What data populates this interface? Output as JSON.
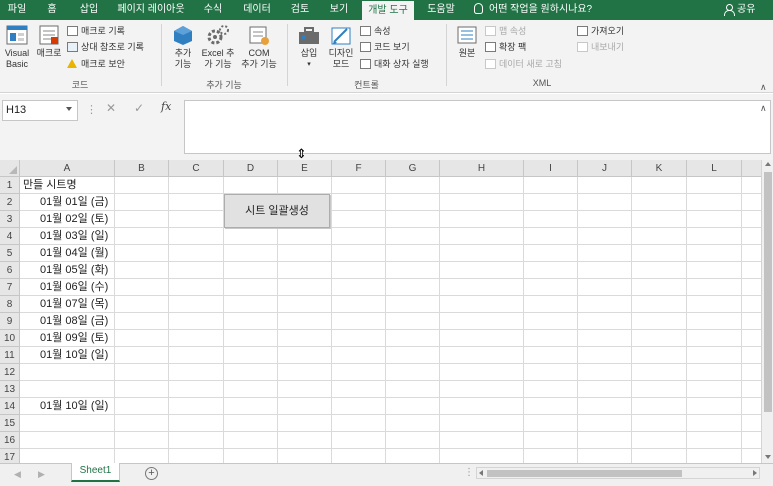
{
  "tabs": [
    "파일",
    "홈",
    "삽입",
    "페이지 레이아웃",
    "수식",
    "데이터",
    "검토",
    "보기",
    "개발 도구",
    "도움말"
  ],
  "active_tab": "개발 도구",
  "tell_me": "어떤 작업을 원하시나요?",
  "share": "공유",
  "ribbon": {
    "code": {
      "visual_basic": [
        "Visual",
        "Basic"
      ],
      "macro": "매크로",
      "record_macro": "매크로 기록",
      "relative_ref": "상대 참조로 기록",
      "macro_security": "매크로 보안",
      "group_label": "코드"
    },
    "addins": {
      "addins": [
        "추가",
        "기능"
      ],
      "excel_addins": [
        "Excel 추",
        "가 기능"
      ],
      "com_addins": [
        "COM",
        "추가 기능"
      ],
      "group_label": "추가 기능"
    },
    "controls": {
      "insert": "삽입",
      "design_mode": [
        "디자인",
        "모드"
      ],
      "properties": "속성",
      "view_code": "코드 보기",
      "run_dialog": "대화 상자 실행",
      "group_label": "컨트롤"
    },
    "xml": {
      "source": "원본",
      "map_properties": "맵 속성",
      "expansion_packs": "확장 팩",
      "refresh_data": "데이터 새로 고침",
      "import": "가져오기",
      "export": "내보내기",
      "group_label": "XML"
    }
  },
  "name_box": "H13",
  "formula_bar": {
    "cancel": "✕",
    "enter": "✓",
    "fx": "fx",
    "content": ""
  },
  "columns": [
    "A",
    "B",
    "C",
    "D",
    "E",
    "F",
    "G",
    "H",
    "I",
    "J",
    "K",
    "L"
  ],
  "rows": [
    "1",
    "2",
    "3",
    "4",
    "5",
    "6",
    "7",
    "8",
    "9",
    "10",
    "11",
    "12",
    "13",
    "14",
    "15",
    "16",
    "17"
  ],
  "cells": {
    "A1": "만들 시트명",
    "A2": "01월 01일 (금)",
    "A3": "01월 02일 (토)",
    "A4": "01월 03일 (일)",
    "A5": "01월 04일 (월)",
    "A6": "01월 05일 (화)",
    "A7": "01월 06일 (수)",
    "A8": "01월 07일 (목)",
    "A9": "01월 08일 (금)",
    "A10": "01월 09일 (토)",
    "A11": "01월 10일 (일)",
    "A14": "01월 10일 (일)"
  },
  "generate_button": "시트 일괄생성",
  "sheet_tab": "Sheet1",
  "add_sheet": "+",
  "colors": {
    "brand": "#217346",
    "ribbon_bg": "#f3f3f3",
    "header_bg": "#e6e6e6",
    "gridline": "#dadada"
  }
}
